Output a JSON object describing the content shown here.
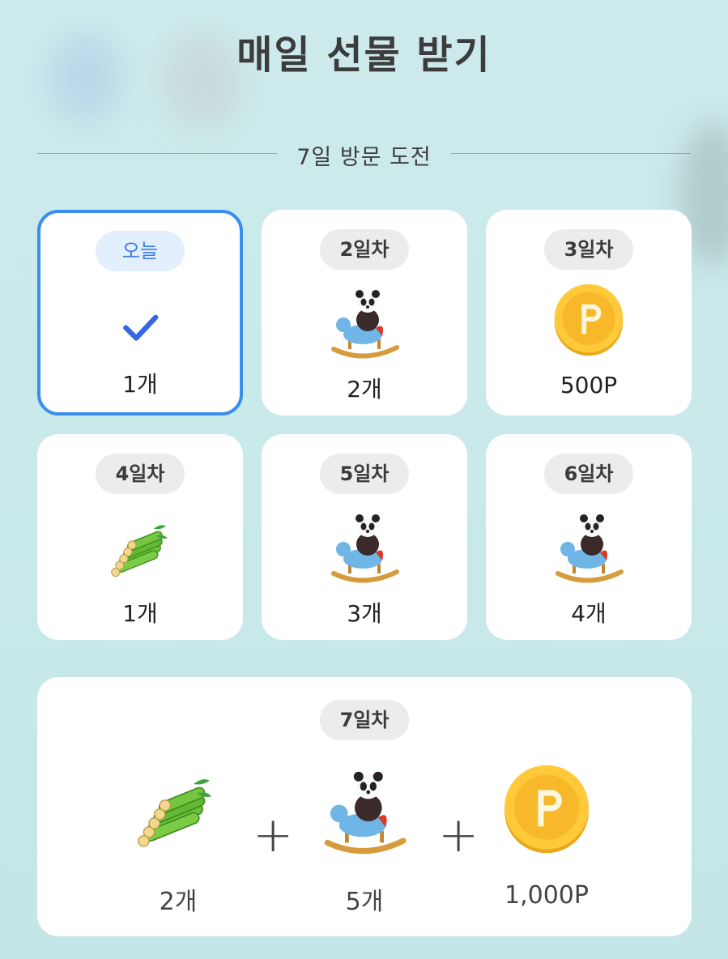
{
  "title": "매일 선물 받기",
  "subtitle": "7일 방문 도전",
  "days": [
    {
      "label": "오늘",
      "qty": "1개",
      "reward": "check-icon",
      "today": true
    },
    {
      "label": "2일차",
      "qty": "2개",
      "reward": "panda-rocking-horse-icon"
    },
    {
      "label": "3일차",
      "qty": "500P",
      "reward": "gold-coin-icon"
    },
    {
      "label": "4일차",
      "qty": "1개",
      "reward": "bamboo-bundle-icon"
    },
    {
      "label": "5일차",
      "qty": "3개",
      "reward": "panda-rocking-horse-icon"
    },
    {
      "label": "6일차",
      "qty": "4개",
      "reward": "panda-rocking-horse-icon"
    }
  ],
  "final_day": {
    "label": "7일차",
    "rewards": [
      {
        "icon": "bamboo-bundle-icon",
        "qty": "2개"
      },
      {
        "icon": "panda-rocking-horse-icon",
        "qty": "5개"
      },
      {
        "icon": "gold-coin-icon",
        "qty": "1,000P"
      }
    ],
    "plus": "+"
  },
  "colors": {
    "today_border": "#3a8ef0",
    "today_pill": "#e4effd",
    "check": "#3568e0",
    "background": "#cdeaec"
  }
}
